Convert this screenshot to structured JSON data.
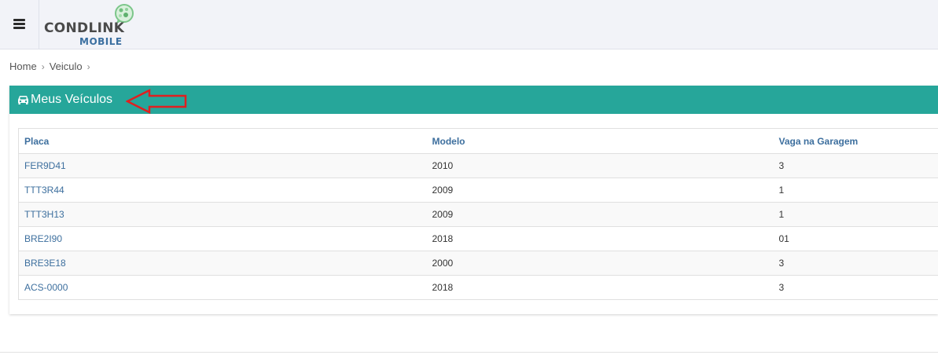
{
  "logo": {
    "name": "CONDLINK",
    "sub": "MOBILE"
  },
  "breadcrumb": {
    "items": [
      "Home",
      "Veiculo"
    ]
  },
  "panel": {
    "title": "Meus Veículos"
  },
  "table": {
    "headers": [
      "Placa",
      "Modelo",
      "Vaga na Garagem"
    ],
    "rows": [
      [
        "FER9D41",
        "2010",
        "3"
      ],
      [
        "TTT3R44",
        "2009",
        "1"
      ],
      [
        "TTT3H13",
        "2009",
        "1"
      ],
      [
        "BRE2I90",
        "2018",
        "01"
      ],
      [
        "BRE3E18",
        "2000",
        "3"
      ],
      [
        "ACS-0000",
        "2018",
        "3"
      ]
    ]
  },
  "colors": {
    "accent": "#26a69a",
    "link": "#3d6f9e",
    "annotation": "#e02020"
  },
  "icons": {
    "menu": "hamburger-icon",
    "vehicle": "car-icon",
    "annotation": "left-arrow-icon"
  }
}
